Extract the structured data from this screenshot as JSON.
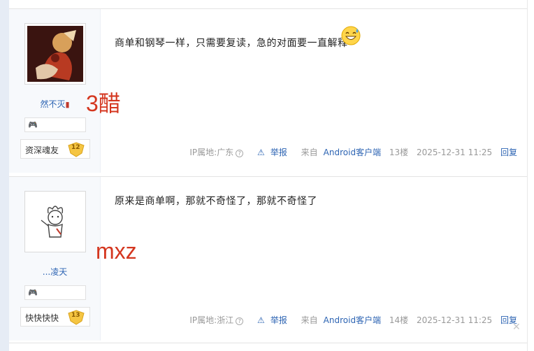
{
  "posts": [
    {
      "username": "然不灭",
      "overlay": "3醋",
      "level_title": "资深魂友",
      "level": "12",
      "content": "商单和钢琴一样，只需要复读，急的对面要一直解释",
      "ip": "IP属地:广东",
      "report": "举报",
      "from": "来自",
      "client": "Android客户端",
      "floor": "13楼",
      "time": "2025-12-31 11:25",
      "reply": "回复"
    },
    {
      "username": "...凌天",
      "overlay": "mxz",
      "level_title": "快快快快",
      "level": "13",
      "content": "原来是商单啊，那就不奇怪了，那就不奇怪了",
      "ip": "IP属地:浙江",
      "report": "举报",
      "from": "来自",
      "client": "Android客户端",
      "floor": "14楼",
      "time": "2025-12-31 11:25",
      "reply": "回复"
    }
  ],
  "icons": {
    "badge": "gamepad-icon",
    "emoji": "grinning-sweat-emoji-icon",
    "help": "question-circle-icon",
    "report": "warning-triangle-icon",
    "close": "close-icon"
  },
  "colors": {
    "link": "#2d64b3",
    "overlay": "#d4361f",
    "meta": "#999999"
  }
}
